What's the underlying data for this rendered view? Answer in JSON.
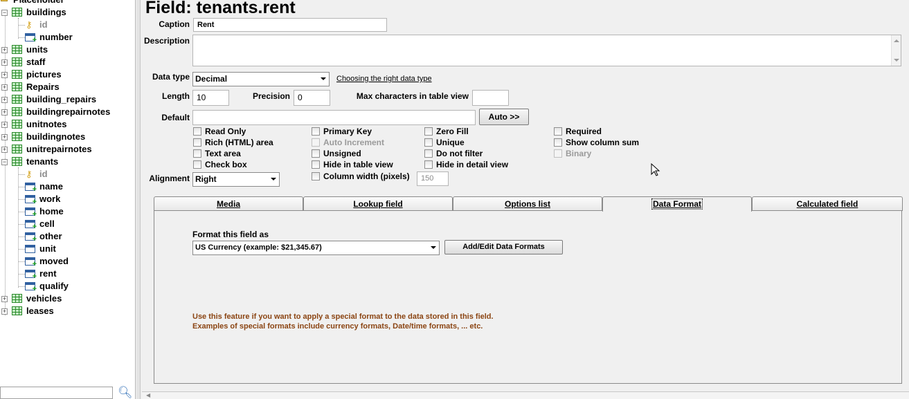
{
  "tree": {
    "root_label": "Placeholder",
    "items": [
      {
        "kind": "table",
        "label": "buildings",
        "expanded": true
      },
      {
        "kind": "field",
        "label": "id",
        "key": true
      },
      {
        "kind": "field",
        "label": "number"
      },
      {
        "kind": "table",
        "label": "units"
      },
      {
        "kind": "table",
        "label": "staff"
      },
      {
        "kind": "table",
        "label": "pictures"
      },
      {
        "kind": "table",
        "label": "Repairs"
      },
      {
        "kind": "table",
        "label": "building_repairs"
      },
      {
        "kind": "table",
        "label": "buildingrepairnotes"
      },
      {
        "kind": "table",
        "label": "unitnotes"
      },
      {
        "kind": "table",
        "label": "buildingnotes"
      },
      {
        "kind": "table",
        "label": "unitrepairnotes"
      },
      {
        "kind": "table",
        "label": "tenants",
        "expanded": true
      },
      {
        "kind": "field",
        "label": "id",
        "key": true
      },
      {
        "kind": "field",
        "label": "name"
      },
      {
        "kind": "field",
        "label": "work"
      },
      {
        "kind": "field",
        "label": "home"
      },
      {
        "kind": "field",
        "label": "cell"
      },
      {
        "kind": "field",
        "label": "other"
      },
      {
        "kind": "field",
        "label": "unit",
        "plain": true
      },
      {
        "kind": "field",
        "label": "moved"
      },
      {
        "kind": "field",
        "label": "rent"
      },
      {
        "kind": "field",
        "label": "qualify"
      },
      {
        "kind": "table",
        "label": "vehicles"
      },
      {
        "kind": "table",
        "label": "leases"
      }
    ]
  },
  "field": {
    "title": "Field: tenants.rent",
    "caption_label": "Caption",
    "caption_value": "Rent",
    "description_label": "Description",
    "description_value": "",
    "data_type_label": "Data type",
    "data_type_value": "Decimal",
    "data_type_link": "Choosing the right data type",
    "length_label": "Length",
    "length_value": "10",
    "precision_label": "Precision",
    "precision_value": "0",
    "max_chars_label": "Max characters in table view",
    "max_chars_value": "",
    "default_label": "Default",
    "default_value": "",
    "auto_button": "Auto >>",
    "alignment_label": "Alignment",
    "alignment_value": "Right",
    "column_width_label": "Column width (pixels)",
    "column_width_value": "150"
  },
  "checkboxes": {
    "read_only": "Read Only",
    "rich_html": "Rich (HTML) area",
    "text_area": "Text area",
    "check_box": "Check box",
    "primary_key": "Primary Key",
    "auto_increment": "Auto Increment",
    "unsigned": "Unsigned",
    "hide_table_view": "Hide in table view",
    "zero_fill": "Zero Fill",
    "unique": "Unique",
    "do_not_filter": "Do not filter",
    "hide_detail_view": "Hide in detail view",
    "required": "Required",
    "show_column_sum": "Show column sum",
    "binary": "Binary",
    "column_width": "Column width (pixels)"
  },
  "tabs": [
    {
      "label": "Media"
    },
    {
      "label": "Lookup field"
    },
    {
      "label": "Options list"
    },
    {
      "label": "Data Format",
      "active": true
    },
    {
      "label": "Calculated field"
    }
  ],
  "data_format": {
    "format_label": "Format this field as",
    "format_value": "US Currency (example: $21,345.67)",
    "add_edit_button": "Add/Edit Data Formats",
    "hint_line1": "Use this feature if you want to apply a special format to the data stored in this field.",
    "hint_line2": "Examples of special formats include currency formats, Date/time formats, ... etc."
  },
  "colors": {
    "hint_text": "#8b4513",
    "table_icon": "#2d8a2d",
    "key_icon": "#d4a017",
    "disabled_text": "#9a9a9a"
  }
}
